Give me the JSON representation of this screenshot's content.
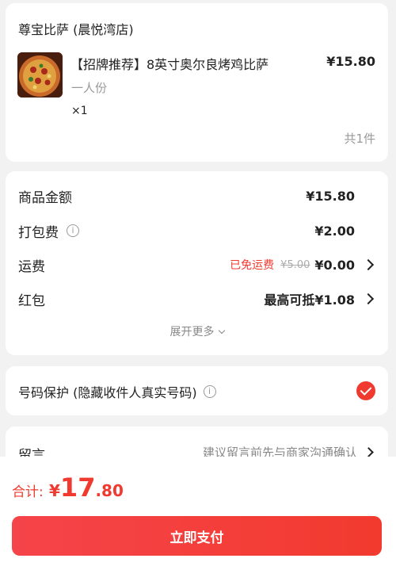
{
  "shop": {
    "name": "尊宝比萨 (晨悦湾店)",
    "item": {
      "title": "【招牌推荐】8英寸奥尔良烤鸡比萨",
      "price": "¥15.80",
      "spec": "一人份",
      "qty": "×1"
    },
    "count": "共1件"
  },
  "costs": {
    "goods_label": "商品金额",
    "goods_value": "¥15.80",
    "packing_label": "打包费",
    "packing_value": "¥2.00",
    "delivery_label": "运费",
    "delivery_free_tag": "已免运费",
    "delivery_original": "¥5.00",
    "delivery_value": "¥0.00",
    "redpacket_label": "红包",
    "redpacket_value": "最高可抵¥1.08",
    "expand_label": "展开更多"
  },
  "protect": {
    "label": "号码保护 (隐藏收件人真实号码)",
    "checked": true
  },
  "message": {
    "label": "留言",
    "hint": "建议留言前先与商家沟通确认"
  },
  "footer": {
    "total_label": "合计:",
    "total_yen": "¥",
    "total_int": "17",
    "total_dec": ".80",
    "pay_label": "立即支付"
  },
  "colors": {
    "accent": "#f03a2f",
    "background": "#f2f2f2"
  }
}
